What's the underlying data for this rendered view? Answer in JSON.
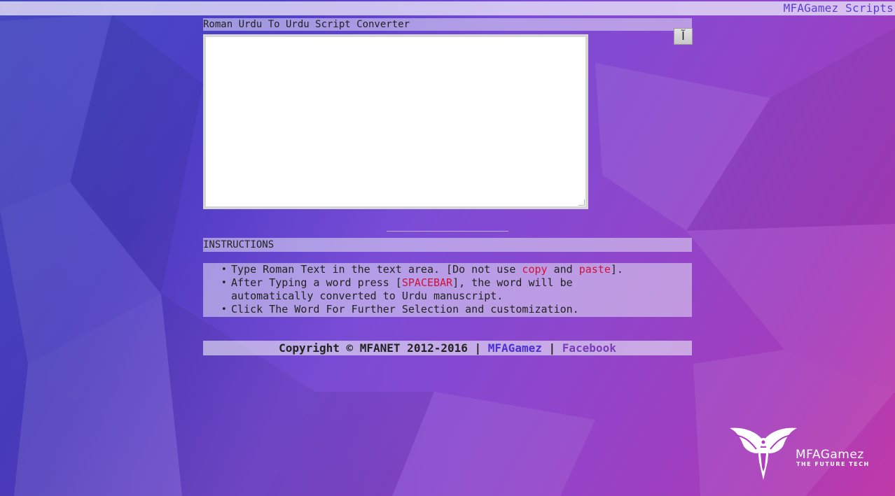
{
  "topbar": {
    "brand": "MFAGamez Scripts"
  },
  "converter": {
    "title": "Roman Urdu To Urdu Script Converter",
    "key_label": "آ",
    "text_value": ""
  },
  "instructions": {
    "heading": "INSTRUCTIONS",
    "items": [
      {
        "pre": "Type Roman Text in the text area. [Do not use ",
        "h1": "copy",
        "mid": " and ",
        "h2": "paste",
        "post": "]."
      },
      {
        "pre": "After Typing a word press [",
        "h1": "SPACEBAR",
        "post": "], the word will be automatically converted to Urdu manuscript."
      },
      {
        "text": "Click The Word For Further Selection and customization."
      }
    ]
  },
  "footer": {
    "copyright": "Copyright © MFANET 2012-2016 |",
    "link1": "MFAGamez",
    "sep": "|",
    "link2": "Facebook"
  },
  "logo": {
    "word": "MFAGamez",
    "tagline": "THE FUTURE TECH"
  },
  "colors": {
    "accent_link": "#4b2fd6",
    "highlight": "#d0103a",
    "bg_start": "#3a3ec0",
    "bg_end": "#c03aa8"
  }
}
